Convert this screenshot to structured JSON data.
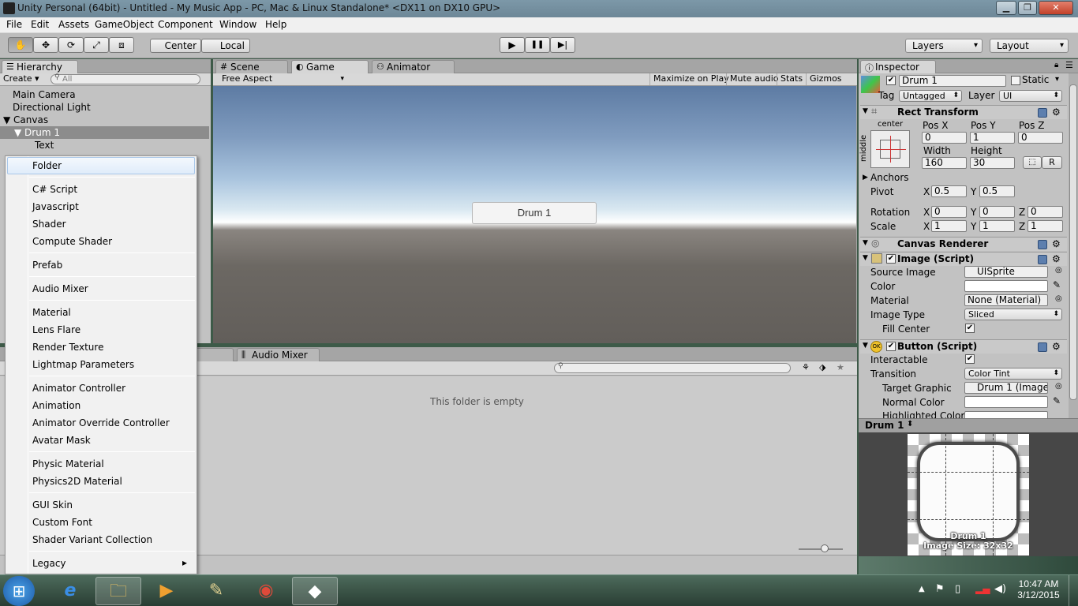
{
  "window": {
    "title": "Unity Personal (64bit) - Untitled - My Music App - PC, Mac & Linux Standalone* <DX11 on DX10 GPU>",
    "controls": {
      "minimize": "▁",
      "maximize": "❐",
      "close": "✕"
    }
  },
  "menubar": {
    "items": [
      "File",
      "Edit",
      "Assets",
      "GameObject",
      "Component",
      "Window",
      "Help"
    ]
  },
  "toolbar": {
    "tools": [
      "hand-tool",
      "move-tool",
      "rotate-tool",
      "scale-tool",
      "rect-tool"
    ],
    "tool_glyphs": [
      "✋",
      "✥",
      "⟳",
      "⤢",
      "⧈"
    ],
    "pivot": "Center",
    "space": "Local",
    "play": "▶",
    "pause": "❚❚",
    "step": "▶|",
    "layers": "Layers",
    "layout": "Layout"
  },
  "hierarchy": {
    "tab": "Hierarchy",
    "create": "Create",
    "search_placeholder": "All",
    "items": [
      "Main Camera",
      "Directional Light",
      "Canvas",
      "Drum 1",
      "Text"
    ]
  },
  "center_tabs": {
    "scene": "Scene",
    "game": "Game",
    "animator": "Animator"
  },
  "game_view": {
    "aspect": "Free Aspect",
    "buttons": [
      "Maximize on Play",
      "Mute audio",
      "Stats",
      "Gizmos"
    ],
    "button_label": "Drum 1"
  },
  "bottom_panel": {
    "tabs": [
      "ole",
      "Audio Mixer"
    ],
    "empty_text": "This folder is empty"
  },
  "context_menu": {
    "groups": [
      [
        "Folder"
      ],
      [
        "C# Script",
        "Javascript",
        "Shader",
        "Compute Shader"
      ],
      [
        "Prefab"
      ],
      [
        "Audio Mixer"
      ],
      [
        "Material",
        "Lens Flare",
        "Render Texture",
        "Lightmap Parameters"
      ],
      [
        "Animator Controller",
        "Animation",
        "Animator Override Controller",
        "Avatar Mask"
      ],
      [
        "Physic Material",
        "Physics2D Material"
      ],
      [
        "GUI Skin",
        "Custom Font",
        "Shader Variant Collection"
      ],
      [
        "Legacy"
      ]
    ],
    "submenu_arrow": "▸"
  },
  "inspector": {
    "tab": "Inspector",
    "object_name": "Drum 1",
    "static_label": "Static",
    "tag_label": "Tag",
    "tag_value": "Untagged",
    "layer_label": "Layer",
    "layer_value": "UI",
    "rect_transform": {
      "title": "Rect Transform",
      "anchor_h": "center",
      "anchor_v": "middle",
      "pos_x_label": "Pos X",
      "pos_y_label": "Pos Y",
      "pos_z_label": "Pos Z",
      "pos_x": "0",
      "pos_y": "1",
      "pos_z": "0",
      "width_label": "Width",
      "height_label": "Height",
      "width": "160",
      "height": "30",
      "r_button": "R",
      "anchors_label": "Anchors",
      "pivot_label": "Pivot",
      "pivot_x": "0.5",
      "pivot_y": "0.5",
      "rotation_label": "Rotation",
      "rot_x": "0",
      "rot_y": "0",
      "rot_z": "0",
      "scale_label": "Scale",
      "scale_x": "1",
      "scale_y": "1",
      "scale_z": "1",
      "x": "X",
      "y": "Y",
      "z": "Z"
    },
    "canvas_renderer": {
      "title": "Canvas Renderer"
    },
    "image": {
      "title": "Image (Script)",
      "source_image_label": "Source Image",
      "source_image": "UISprite",
      "color_label": "Color",
      "material_label": "Material",
      "material": "None (Material)",
      "image_type_label": "Image Type",
      "image_type": "Sliced",
      "fill_center_label": "Fill Center"
    },
    "button": {
      "title": "Button (Script)",
      "interactable_label": "Interactable",
      "transition_label": "Transition",
      "transition": "Color Tint",
      "target_graphic_label": "Target Graphic",
      "target_graphic": "Drum 1 (Image",
      "normal_color_label": "Normal Color",
      "highlighted_color_label": "Highlighted Color"
    }
  },
  "preview": {
    "title": "Drum 1",
    "name": "Drum 1",
    "size": "Image Size: 32x32"
  },
  "taskbar": {
    "apps": [
      "start-button",
      "internet-explorer",
      "file-explorer",
      "media-player",
      "paint-app",
      "chrome",
      "unity"
    ],
    "app_glyphs": [
      "⊞",
      "e",
      "🗀",
      "▶",
      "✎",
      "◉",
      "◆"
    ],
    "time": "10:47 AM",
    "date": "3/12/2015"
  },
  "colors": {
    "accent_blue": "#3a6ea5",
    "panel": "#c2c2c2",
    "selection": "#8c8c8c"
  }
}
